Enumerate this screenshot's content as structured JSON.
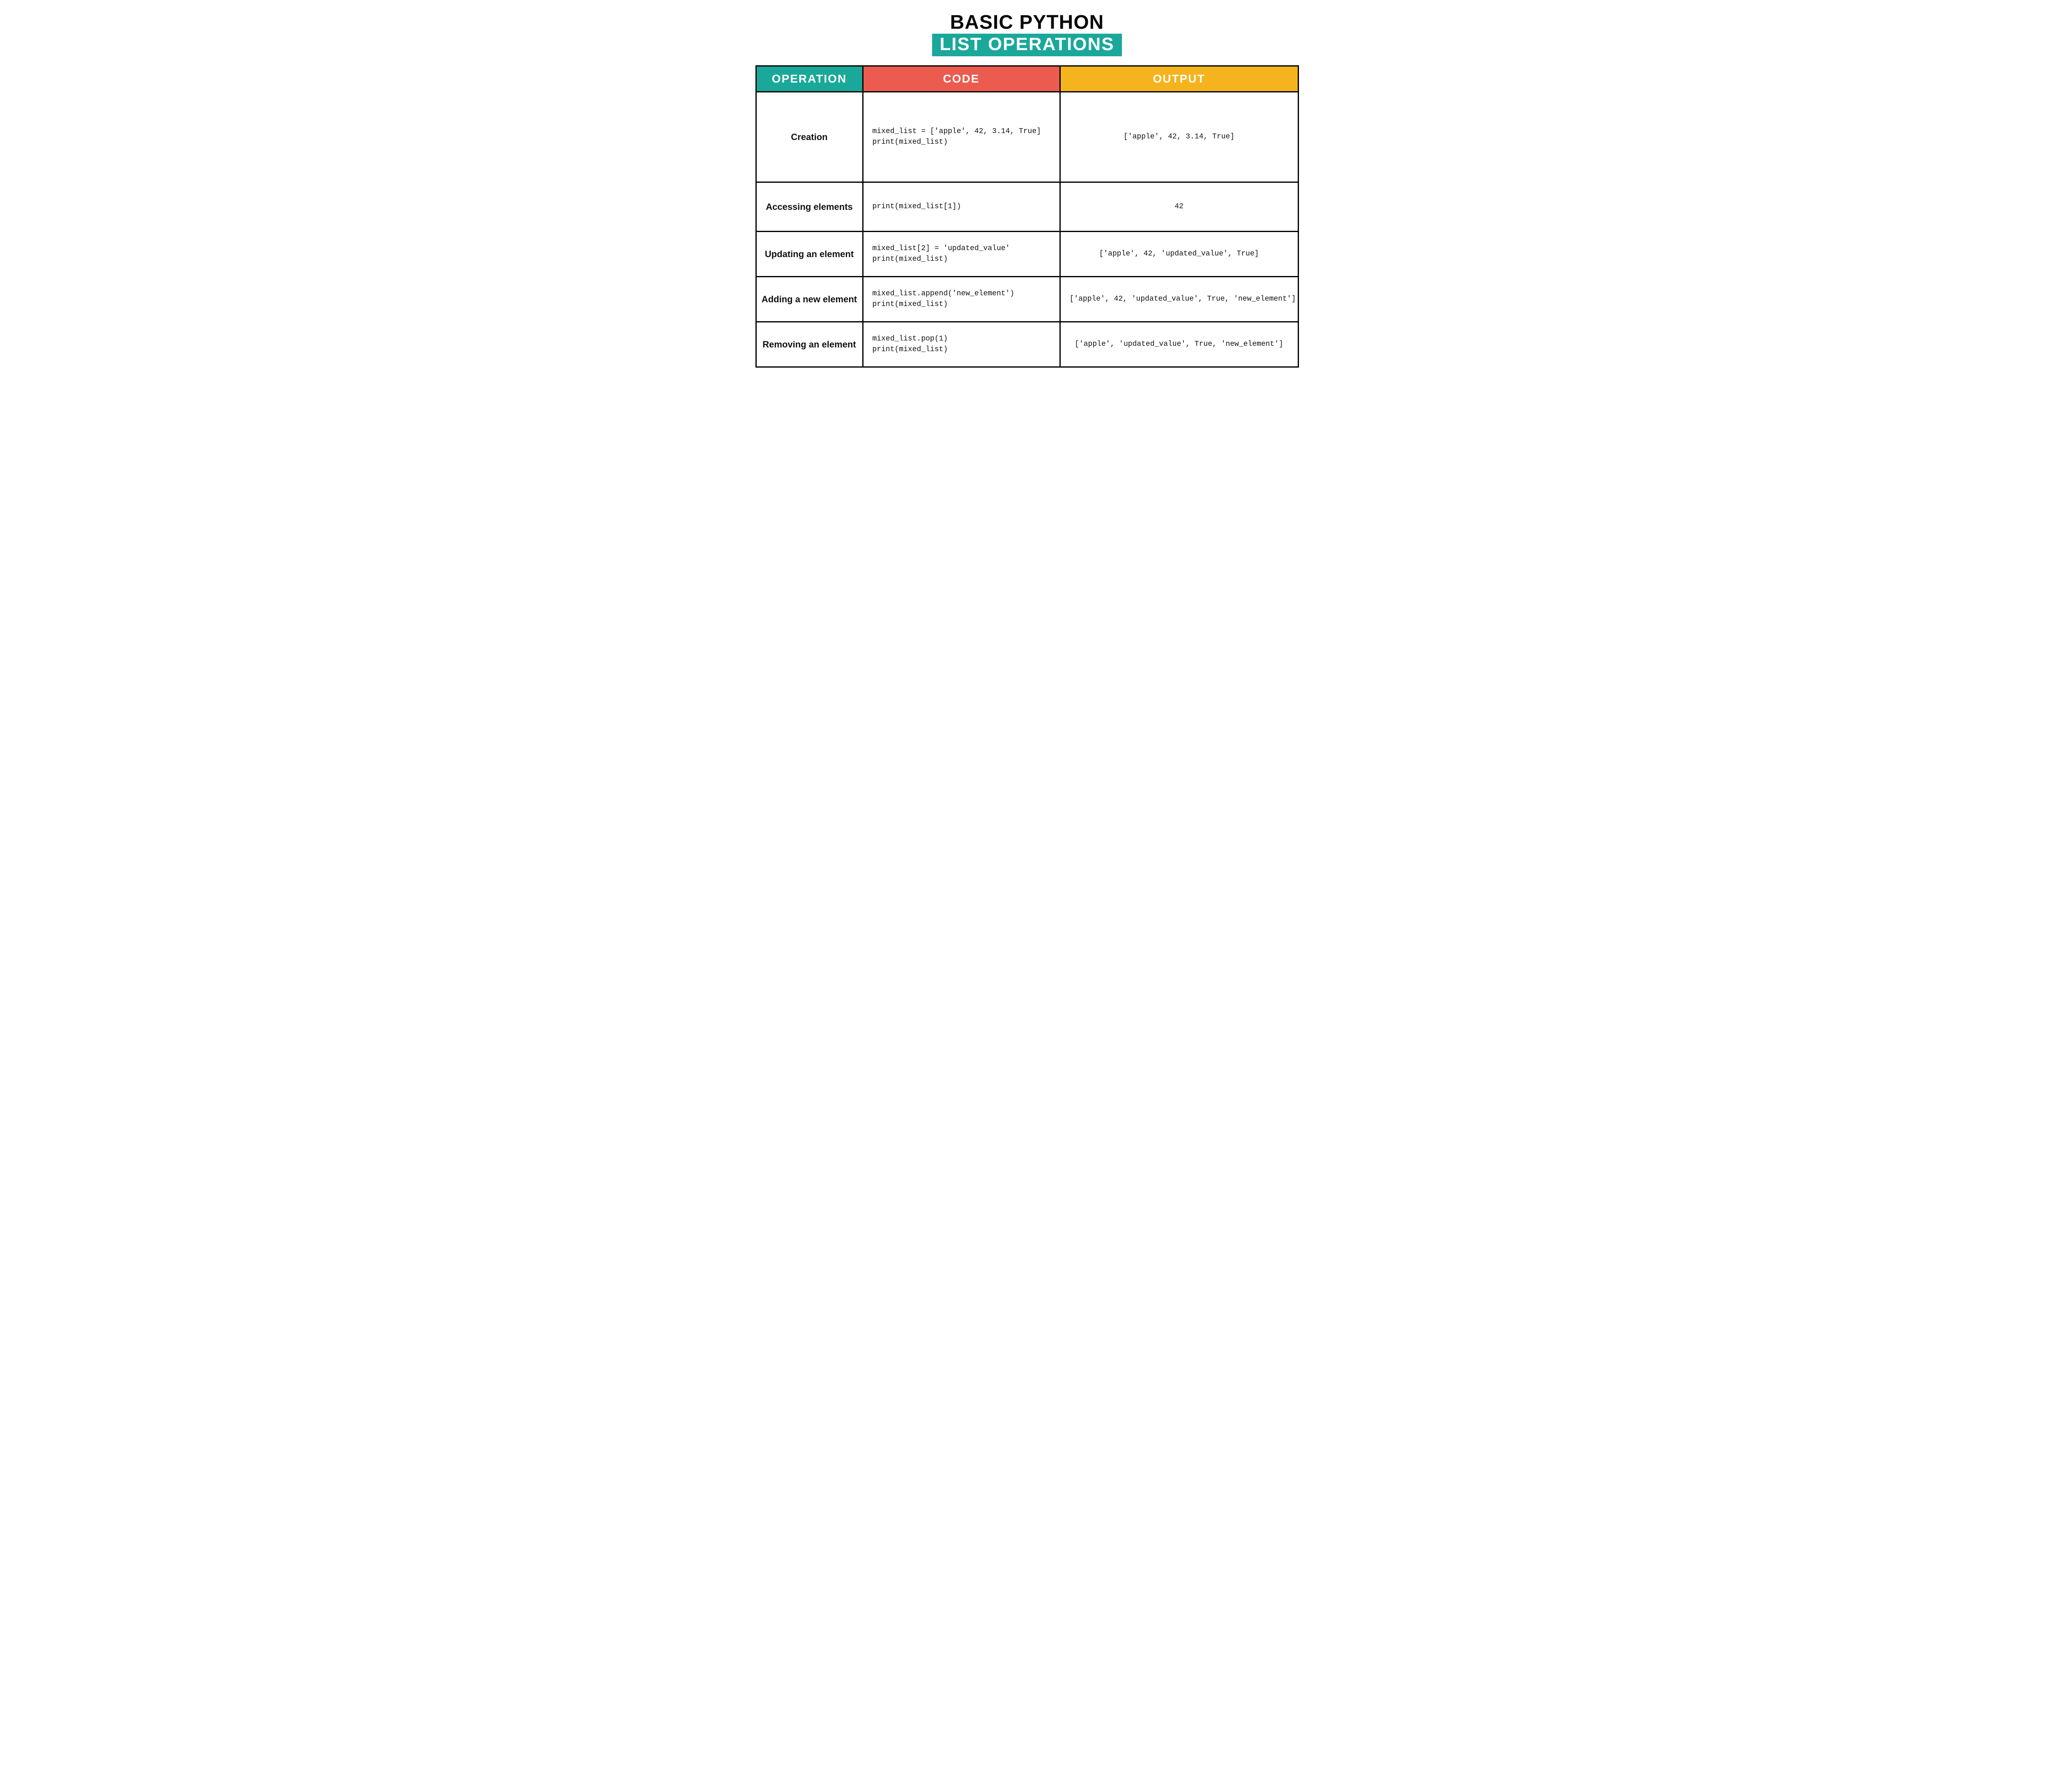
{
  "title": {
    "line1": "BASIC PYTHON",
    "line2": "LIST OPERATIONS"
  },
  "headers": {
    "operation": "OPERATION",
    "code": "CODE",
    "output": "OUTPUT"
  },
  "rows": [
    {
      "operation": "Creation",
      "code": "mixed_list = ['apple', 42, 3.14, True]\nprint(mixed_list)",
      "output": "['apple', 42, 3.14, True]"
    },
    {
      "operation": "Accessing\nelements",
      "code": "print(mixed_list[1])",
      "output": "42"
    },
    {
      "operation": "Updating an\nelement",
      "code": "mixed_list[2] = 'updated_value'\nprint(mixed_list)",
      "output": "['apple', 42, 'updated_value', True]"
    },
    {
      "operation": "Adding a\nnew element",
      "code": "mixed_list.append('new_element')\nprint(mixed_list)",
      "output": "['apple', 42, 'updated_value', True, 'new_element']"
    },
    {
      "operation": "Removing\nan element",
      "code": "mixed_list.pop(1)\nprint(mixed_list)",
      "output": "['apple', 'updated_value', True, 'new_element']"
    }
  ]
}
